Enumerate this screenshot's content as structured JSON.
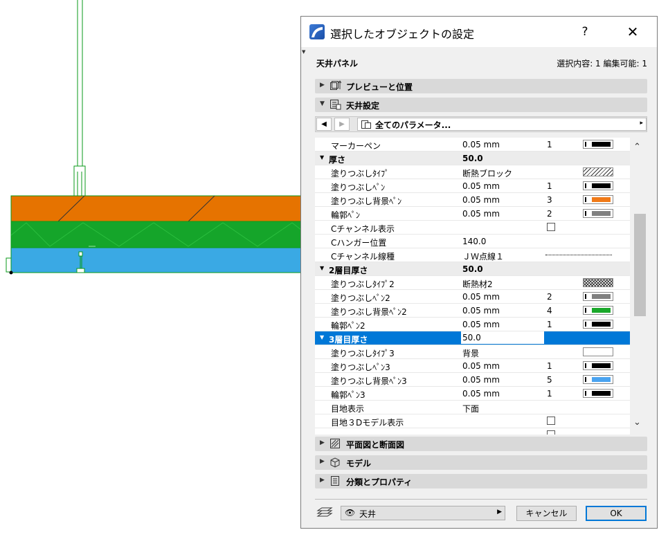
{
  "dialog": {
    "title": "選択したオブジェクトの設定",
    "help_label": "?",
    "close_label": "✕",
    "object_type": "天井パネル",
    "selection_info": "選択内容: 1 編集可能: 1"
  },
  "sections": {
    "preview": "プレビューと位置",
    "ceiling": "天井設定",
    "plan_section": "平面図と断面図",
    "model": "モデル",
    "classification": "分類とプロパティ"
  },
  "nav": {
    "prev_label": "◀",
    "next_label": "▶",
    "dropdown_label": "全てのパラメータ...",
    "arrow": "▸"
  },
  "params": [
    {
      "name": "マーカーペン",
      "value": "0.05 mm",
      "num": "1",
      "swatch": "#000000"
    },
    {
      "name": "厚さ",
      "value": "50.0",
      "group": true
    },
    {
      "name": "塗りつぶしﾀｲﾌﾟ",
      "value": "断熱ブロック",
      "pattern": "hatch"
    },
    {
      "name": "塗りつぶしﾍﾟﾝ",
      "value": "0.05 mm",
      "num": "1",
      "swatch": "#000000"
    },
    {
      "name": "塗りつぶし背景ﾍﾟﾝ",
      "value": "0.05 mm",
      "num": "3",
      "swatch": "#f07a18"
    },
    {
      "name": "輪郭ﾍﾟﾝ",
      "value": "0.05 mm",
      "num": "2",
      "swatch": "#808080"
    },
    {
      "name": "Cチャンネル表示",
      "value": "",
      "checkbox": true
    },
    {
      "name": "Cハンガー位置",
      "value": "140.0"
    },
    {
      "name": "Cチャンネル線種",
      "value": "ＪＷ点線１",
      "dotted": true
    },
    {
      "name": "2層目厚さ",
      "value": "50.0",
      "group": true
    },
    {
      "name": "塗りつぶしﾀｲﾌﾟ2",
      "value": "断熱材2",
      "pattern": "cross"
    },
    {
      "name": "塗りつぶしﾍﾟﾝ2",
      "value": "0.05 mm",
      "num": "2",
      "swatch": "#808080"
    },
    {
      "name": "塗りつぶし背景ﾍﾟﾝ2",
      "value": "0.05 mm",
      "num": "4",
      "swatch": "#1aa82a"
    },
    {
      "name": "輪郭ﾍﾟﾝ2",
      "value": "0.05 mm",
      "num": "1",
      "swatch": "#000000"
    },
    {
      "name": "3層目厚さ",
      "value": "50.0",
      "group": true,
      "selected": true
    },
    {
      "name": "塗りつぶしﾀｲﾌﾟ3",
      "value": "背景",
      "pattern": "blank"
    },
    {
      "name": "塗りつぶしﾍﾟﾝ3",
      "value": "0.05 mm",
      "num": "1",
      "swatch": "#000000"
    },
    {
      "name": "塗りつぶし背景ﾍﾟﾝ3",
      "value": "0.05 mm",
      "num": "5",
      "swatch": "#4aa3f0"
    },
    {
      "name": "輪郭ﾍﾟﾝ3",
      "value": "0.05 mm",
      "num": "1",
      "swatch": "#000000"
    },
    {
      "name": "目地表示",
      "value": "下面"
    },
    {
      "name": "目地３Dモデル表示",
      "value": "",
      "checkbox": true
    },
    {
      "name": "",
      "value": "",
      "checkbox": true
    }
  ],
  "footer": {
    "layer_name": "天井",
    "cancel_label": "キャンセル",
    "ok_label": "OK"
  },
  "colors": {
    "orange_layer": "#e67300",
    "green_layer": "#15a52a",
    "blue_layer": "#3aa9e4",
    "accent": "#0078d7"
  }
}
